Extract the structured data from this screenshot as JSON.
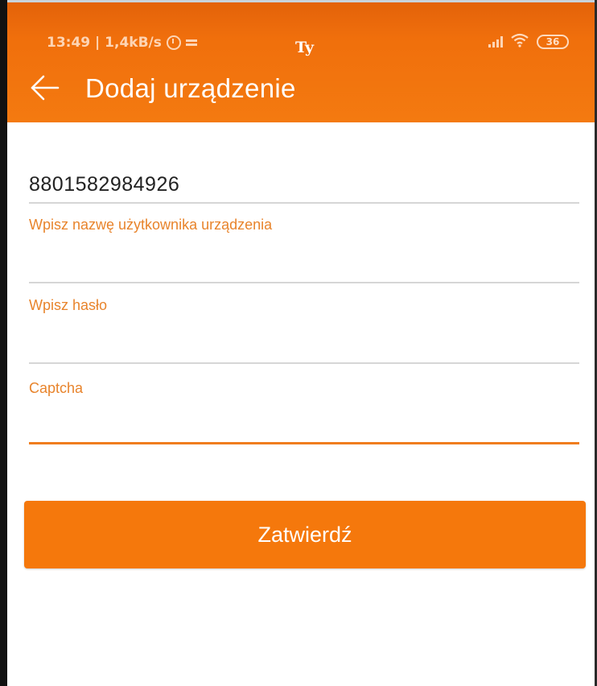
{
  "status_bar": {
    "time_and_speed": "13:49 | 1,4kB/s",
    "center_text": "Ty",
    "battery": "36"
  },
  "header": {
    "title": "Dodaj urządzenie",
    "back_icon": "arrow-left-icon"
  },
  "form": {
    "device_id": {
      "value": "8801582984926"
    },
    "username": {
      "label": "Wpisz nazwę użytkownika urządzenia",
      "value": ""
    },
    "password": {
      "label": "Wpisz hasło",
      "value": ""
    },
    "captcha": {
      "label": "Captcha",
      "value": ""
    }
  },
  "submit": {
    "label": "Zatwierdź"
  },
  "colors": {
    "primary": "#f47a10",
    "label": "#e8842c",
    "active_underline": "#f07d1e",
    "inactive_underline": "#d6d6d6"
  }
}
